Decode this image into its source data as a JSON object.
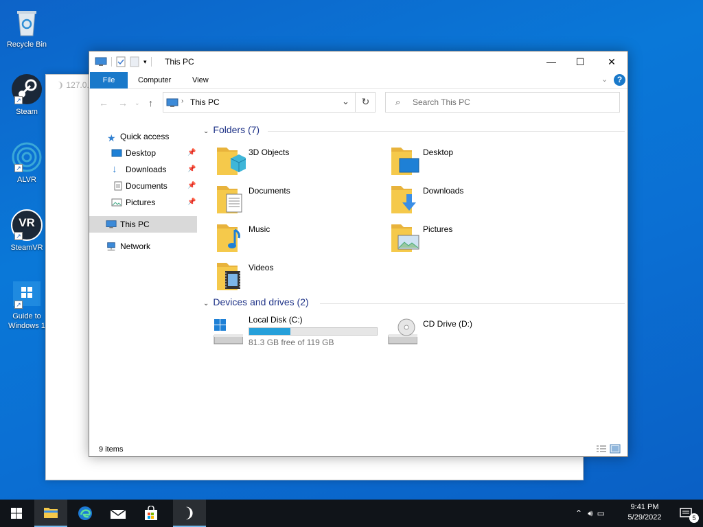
{
  "desktop": {
    "icons": [
      {
        "label": "Recycle Bin",
        "icon": "recycle-bin-icon"
      },
      {
        "label": "Steam",
        "icon": "steam-icon"
      },
      {
        "label": "ALVR",
        "icon": "alvr-icon"
      },
      {
        "label": "SteamVR",
        "icon": "steamvr-icon",
        "badge": "VR"
      },
      {
        "label": "Guide to Windows 1",
        "icon": "windows-guide-icon"
      }
    ]
  },
  "background_window": {
    "url": "127.0.0."
  },
  "explorer": {
    "title": "This PC",
    "ribbon_tabs": [
      "File",
      "Computer",
      "View"
    ],
    "address": {
      "path": "This PC"
    },
    "search": {
      "placeholder": "Search This PC"
    },
    "nav": {
      "quick_access": "Quick access",
      "items": [
        {
          "label": "Desktop",
          "icon": "desktop-icon"
        },
        {
          "label": "Downloads",
          "icon": "downloads-icon"
        },
        {
          "label": "Documents",
          "icon": "documents-icon"
        },
        {
          "label": "Pictures",
          "icon": "pictures-icon"
        }
      ],
      "this_pc": "This PC",
      "network": "Network"
    },
    "folders": {
      "header": "Folders (7)",
      "items": [
        {
          "label": "3D Objects",
          "icon": "3d-objects-folder-icon"
        },
        {
          "label": "Desktop",
          "icon": "desktop-folder-icon"
        },
        {
          "label": "Documents",
          "icon": "documents-folder-icon"
        },
        {
          "label": "Downloads",
          "icon": "downloads-folder-icon"
        },
        {
          "label": "Music",
          "icon": "music-folder-icon"
        },
        {
          "label": "Pictures",
          "icon": "pictures-folder-icon"
        },
        {
          "label": "Videos",
          "icon": "videos-folder-icon"
        }
      ]
    },
    "devices": {
      "header": "Devices and drives (2)",
      "items": [
        {
          "label": "Local Disk (C:)",
          "free": "81.3 GB free of 119 GB",
          "used_fraction": 0.32
        },
        {
          "label": "CD Drive (D:)"
        }
      ]
    },
    "status": "9 items"
  },
  "taskbar": {
    "apps": [
      {
        "name": "file-explorer",
        "icon": "folder-icon"
      },
      {
        "name": "edge",
        "icon": "edge-icon"
      },
      {
        "name": "mail",
        "icon": "mail-icon"
      },
      {
        "name": "store",
        "icon": "store-icon"
      },
      {
        "name": "alvr",
        "icon": "alvr-icon"
      }
    ],
    "time": "9:41 PM",
    "date": "5/29/2022",
    "notifications": "5"
  },
  "colors": {
    "accent": "#1979ca",
    "drive_fill": "#26a0da",
    "folder": "#f5c94b",
    "taskbar": "#101419"
  }
}
